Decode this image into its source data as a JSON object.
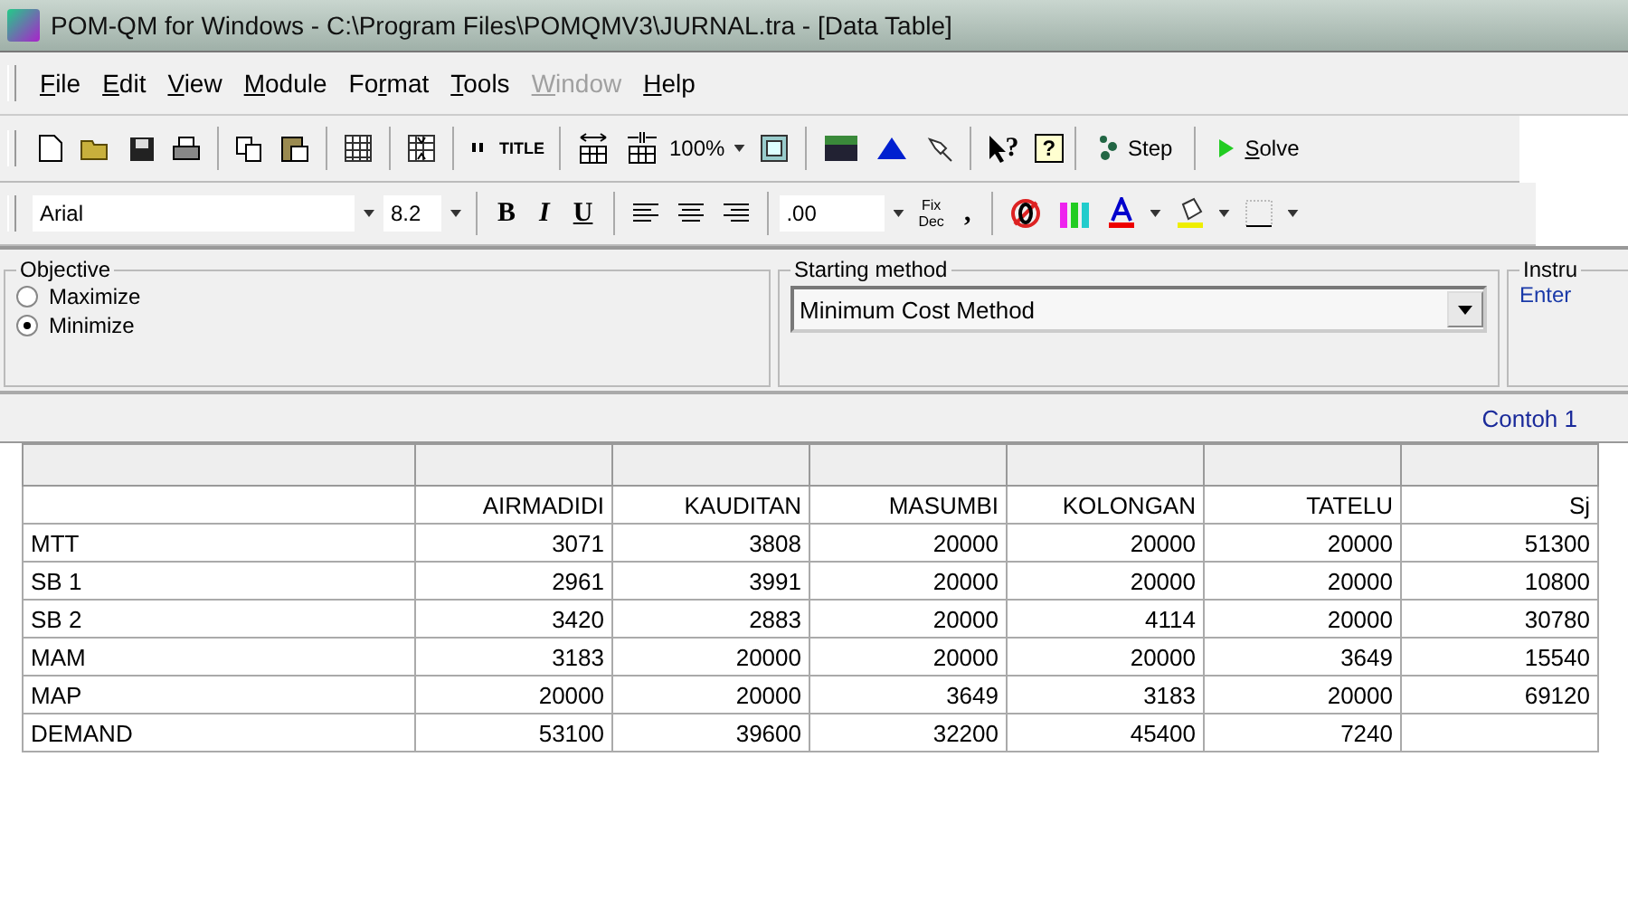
{
  "window": {
    "title": "POM-QM for Windows - C:\\Program Files\\POMQMV3\\JURNAL.tra - [Data Table]"
  },
  "menu": [
    {
      "key": "F",
      "post": "ile",
      "disabled": false
    },
    {
      "key": "E",
      "post": "dit",
      "disabled": false
    },
    {
      "key": "V",
      "post": "iew",
      "disabled": false
    },
    {
      "key": "M",
      "post": "odule",
      "disabled": false
    },
    {
      "pre": "Fo",
      "key": "r",
      "post": "mat",
      "disabled": false
    },
    {
      "key": "T",
      "post": "ools",
      "disabled": false
    },
    {
      "key": "W",
      "post": "indow",
      "disabled": true
    },
    {
      "key": "H",
      "post": "elp",
      "disabled": false
    }
  ],
  "toolbar": {
    "title_button": "TITLE",
    "zoom": "100%",
    "whats_this": "?",
    "help": "?",
    "step": "Step",
    "solve": {
      "key": "S",
      "post": "olve"
    }
  },
  "format_bar": {
    "font": "Arial",
    "size": "8.2",
    "bold": "B",
    "italic": "I",
    "underline": "U",
    "decimals": ".00",
    "fix_top": "Fix",
    "fix_bottom": "Dec",
    "comma": ","
  },
  "objective": {
    "legend": "Objective",
    "options": [
      {
        "label": "Maximize",
        "selected": false
      },
      {
        "label": "Minimize",
        "selected": true
      }
    ]
  },
  "starting_method": {
    "legend": "Starting method",
    "value": "Minimum Cost Method"
  },
  "instructions": {
    "legend": "Instru",
    "text": "Enter"
  },
  "caption": "Contoh 1",
  "table": {
    "columns": [
      "AIRMADIDI",
      "KAUDITAN",
      "MASUMBI",
      "KOLONGAN",
      "TATELU",
      "Sj"
    ],
    "rows": [
      {
        "label": "MTT",
        "cells": [
          "3071",
          "3808",
          "20000",
          "20000",
          "20000",
          "51300"
        ]
      },
      {
        "label": "SB 1",
        "cells": [
          "2961",
          "3991",
          "20000",
          "20000",
          "20000",
          "10800"
        ]
      },
      {
        "label": "SB 2",
        "cells": [
          "3420",
          "2883",
          "20000",
          "4114",
          "20000",
          "30780"
        ]
      },
      {
        "label": "MAM",
        "cells": [
          "3183",
          "20000",
          "20000",
          "20000",
          "3649",
          "15540"
        ]
      },
      {
        "label": "MAP",
        "cells": [
          "20000",
          "20000",
          "3649",
          "3183",
          "20000",
          "69120"
        ]
      },
      {
        "label": "DEMAND",
        "cells": [
          "53100",
          "39600",
          "32200",
          "45400",
          "7240",
          ""
        ]
      }
    ]
  }
}
